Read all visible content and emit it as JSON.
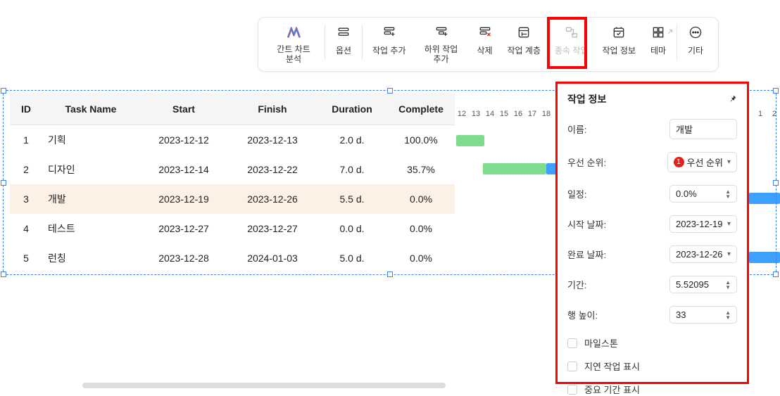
{
  "toolbar": {
    "items": [
      {
        "label": "간트 차트 분석",
        "icon": "logo"
      },
      {
        "label": "옵션",
        "icon": "options"
      },
      {
        "label": "작업 추가",
        "icon": "add-task"
      },
      {
        "label": "하위 작업 추가",
        "icon": "add-subtask"
      },
      {
        "label": "삭제",
        "icon": "delete"
      },
      {
        "label": "작업 계층",
        "icon": "hierarchy"
      },
      {
        "label": "종속 작업",
        "icon": "dependency",
        "disabled": true
      },
      {
        "label": "작업 정보",
        "icon": "task-info",
        "highlight": true
      },
      {
        "label": "테마",
        "icon": "theme"
      },
      {
        "label": "기타",
        "icon": "more"
      }
    ]
  },
  "grid": {
    "headers": {
      "id": "ID",
      "name": "Task Name",
      "start": "Start",
      "finish": "Finish",
      "duration": "Duration",
      "complete": "Complete"
    },
    "rows": [
      {
        "id": "1",
        "name": "기획",
        "start": "2023-12-12",
        "finish": "2023-12-13",
        "duration": "2.0 d.",
        "complete": "100.0%"
      },
      {
        "id": "2",
        "name": "디자인",
        "start": "2023-12-14",
        "finish": "2023-12-22",
        "duration": "7.0 d.",
        "complete": "35.7%"
      },
      {
        "id": "3",
        "name": "개발",
        "start": "2023-12-19",
        "finish": "2023-12-26",
        "duration": "5.5 d.",
        "complete": "0.0%",
        "selected": true
      },
      {
        "id": "4",
        "name": "테스트",
        "start": "2023-12-27",
        "finish": "2023-12-27",
        "duration": "0.0 d.",
        "complete": "0.0%"
      },
      {
        "id": "5",
        "name": "런칭",
        "start": "2023-12-28",
        "finish": "2024-01-03",
        "duration": "5.0 d.",
        "complete": "0.0%"
      }
    ]
  },
  "timeline": {
    "days": [
      "12",
      "13",
      "14",
      "15",
      "16",
      "17",
      "18"
    ],
    "right": [
      "1",
      "2"
    ]
  },
  "panel": {
    "title": "작업 정보",
    "fields": {
      "name_label": "이름:",
      "name_value": "개발",
      "priority_label": "우선 순위:",
      "priority_value": "우선 순위",
      "priority_badge": "1",
      "progress_label": "일정:",
      "progress_value": "0.0%",
      "start_label": "시작 날짜:",
      "start_value": "2023-12-19",
      "end_label": "완료 날짜:",
      "end_value": "2023-12-26",
      "duration_label": "기간:",
      "duration_value": "5.52095",
      "rowheight_label": "행 높이:",
      "rowheight_value": "33"
    },
    "checks": {
      "milestone": "마일스톤",
      "delayed": "지연 작업 표시",
      "critical": "중요 기간 표시"
    }
  }
}
